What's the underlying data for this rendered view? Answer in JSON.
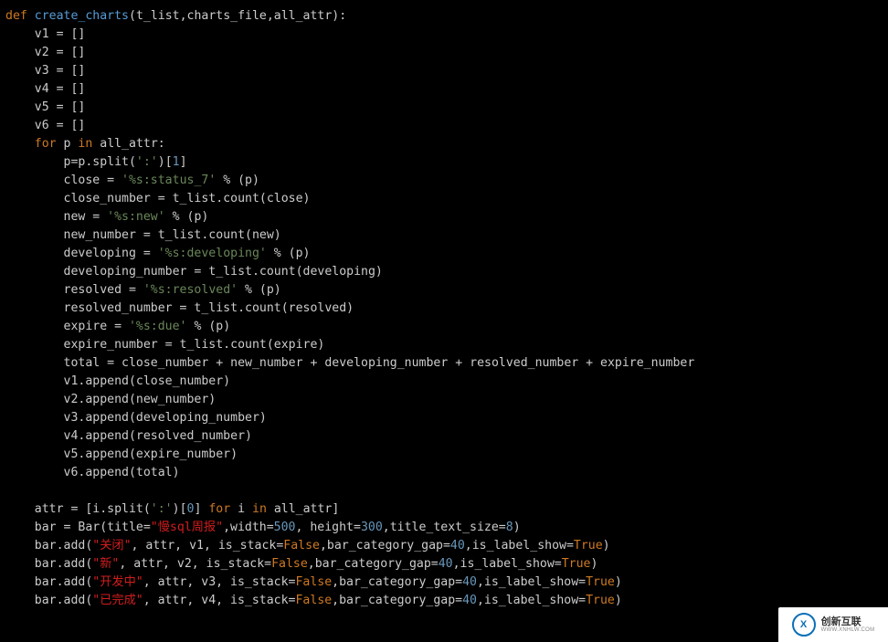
{
  "code": {
    "l1": {
      "kw": "def",
      "fn": "create_charts",
      "params": "(t_list,charts_file,all_attr):"
    },
    "l2": "    v1 = []",
    "l3": "    v2 = []",
    "l4": "    v3 = []",
    "l5": "    v4 = []",
    "l6": "    v5 = []",
    "l7": "    v6 = []",
    "l8": {
      "pre": "    ",
      "kw1": "for",
      "mid": " p ",
      "kw2": "in",
      "post": " all_attr:"
    },
    "l9": {
      "pre": "        p=p.split(",
      "s": "':'",
      "post": ")[",
      "n": "1",
      "tail": "]"
    },
    "l10": {
      "pre": "        close = ",
      "s": "'%s:status_7'",
      "post": " % (p)"
    },
    "l11": "        close_number = t_list.count(close)",
    "l12": {
      "pre": "        new = ",
      "s": "'%s:new'",
      "post": " % (p)"
    },
    "l13": "        new_number = t_list.count(new)",
    "l14": {
      "pre": "        developing = ",
      "s": "'%s:developing'",
      "post": " % (p)"
    },
    "l15": "        developing_number = t_list.count(developing)",
    "l16": {
      "pre": "        resolved = ",
      "s": "'%s:resolved'",
      "post": " % (p)"
    },
    "l17": "        resolved_number = t_list.count(resolved)",
    "l18": {
      "pre": "        expire = ",
      "s": "'%s:due'",
      "post": " % (p)"
    },
    "l19": "        expire_number = t_list.count(expire)",
    "l20": "        total = close_number + new_number + developing_number + resolved_number + expire_number",
    "l21": "        v1.append(close_number)",
    "l22": "        v2.append(new_number)",
    "l23": "        v3.append(developing_number)",
    "l24": "        v4.append(resolved_number)",
    "l25": "        v5.append(expire_number)",
    "l26": "        v6.append(total)",
    "l27": "",
    "l28": {
      "pre": "    attr = [i.split(",
      "s": "':'",
      "post": ")[",
      "n": "0",
      "post2": "] ",
      "kw1": "for",
      "mid": " i ",
      "kw2": "in",
      "tail": " all_attr]"
    },
    "l29": {
      "pre": "    bar = Bar(title=",
      "s": "\"慢sql周报\"",
      "post": ",width=",
      "n1": "500",
      "post2": ", height=",
      "n2": "300",
      "post3": ",title_text_size=",
      "n3": "8",
      "tail": ")"
    },
    "l30": {
      "pre": "    bar.add(",
      "s": "\"关闭\"",
      "post": ", attr, v1, is_stack=",
      "b1": "False",
      "post2": ",bar_category_gap=",
      "n": "40",
      "post3": ",is_label_show=",
      "b2": "True",
      "tail": ")"
    },
    "l31": {
      "pre": "    bar.add(",
      "s": "\"新\"",
      "post": ", attr, v2, is_stack=",
      "b1": "False",
      "post2": ",bar_category_gap=",
      "n": "40",
      "post3": ",is_label_show=",
      "b2": "True",
      "tail": ")"
    },
    "l32": {
      "pre": "    bar.add(",
      "s": "\"开发中\"",
      "post": ", attr, v3, is_stack=",
      "b1": "False",
      "post2": ",bar_category_gap=",
      "n": "40",
      "post3": ",is_label_show=",
      "b2": "True",
      "tail": ")"
    },
    "l33": {
      "pre": "    bar.add(",
      "s": "\"已完成\"",
      "post": ", attr, v4, is_stack=",
      "b1": "False",
      "post2": ",bar_category_gap=",
      "n": "40",
      "post3": ",is_label_show=",
      "b2": "True",
      "tail": ")"
    }
  },
  "logo": {
    "cn": "创新互联",
    "en": "WWW.XNHLW.COM",
    "mark": "X"
  }
}
